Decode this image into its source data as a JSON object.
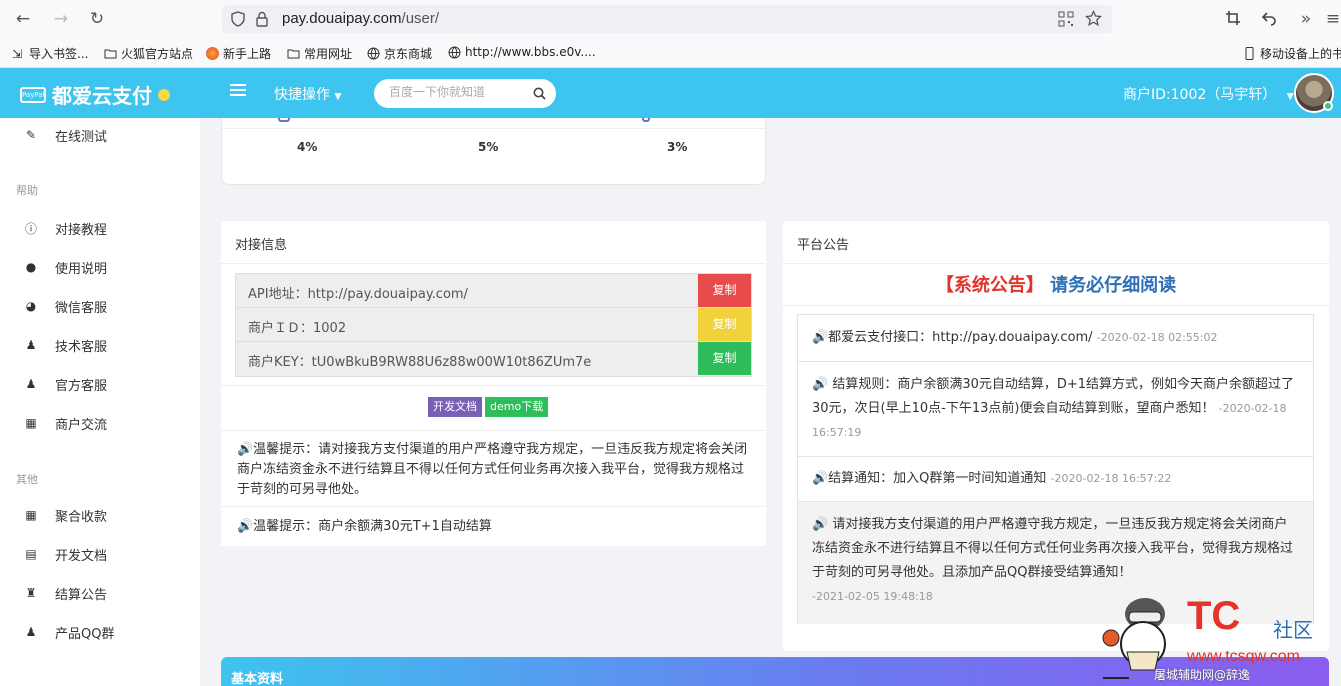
{
  "browser": {
    "url_host": "pay.douaipay.com",
    "url_path": "/user/",
    "bookmarks": [
      "导入书签...",
      "火狐官方站点",
      "新手上路",
      "常用网址",
      "京东商城",
      "http://www.bbs.e0v....",
      "移动设备上的书"
    ]
  },
  "header": {
    "brand": "都爱云支付",
    "brand_logo_text": "PayPal",
    "quick_menu": "快捷操作",
    "search_placeholder": "百度一下你就知道",
    "merchant": "商户ID:1002（马宇轩）"
  },
  "sidebar": {
    "top_item": "在线测试",
    "section_help": "帮助",
    "help_items": [
      "对接教程",
      "使用说明",
      "微信客服",
      "技术客服",
      "官方客服",
      "商户交流"
    ],
    "section_other": "其他",
    "other_items": [
      "聚合收款",
      "开发文档",
      "结算公告",
      "产品QQ群"
    ]
  },
  "stats": {
    "values": [
      "4%",
      "5%",
      "3%"
    ]
  },
  "dock": {
    "title": "对接信息",
    "rows": [
      {
        "text": "API地址：http://pay.douaipay.com/",
        "button": "复制",
        "color": "#e84b4b"
      },
      {
        "text": "商户ＩＤ：1002",
        "button": "复制",
        "color": "#f1d23a"
      },
      {
        "text": "商户KEY：tU0wBkuB9RW88U6z88w00W10t86ZUm7e",
        "button": "复制",
        "color": "#2ebd5a"
      }
    ],
    "doc_button": "开发文档",
    "demo_button": "demo下载",
    "tip1": "🔊温馨提示：请对接我方支付渠道的用户严格遵守我方规定，一旦违反我方规定将会关闭商户冻结资金永不进行结算且不得以任何方式任何业务再次接入我平台，觉得我方规格过于苛刻的可另寻他处。",
    "tip2": "🔊温馨提示：商户余额满30元T+1自动结算"
  },
  "notice": {
    "title": "平台公告",
    "headline_red": "【系统公告】",
    "headline_blue": "请务必仔细阅读",
    "items": [
      {
        "text": "🔊都爱云支付接口：http://pay.douaipay.com/",
        "time": "-2020-02-18 02:55:02"
      },
      {
        "text": "🔊 结算规则：商户余额满30元自动结算，D+1结算方式，例如今天商户余额超过了30元，次日(早上10点-下午13点前)便会自动结算到账，望商户悉知！",
        "time": "-2020-02-18 16:57:19"
      },
      {
        "text": "🔊结算通知：加入Q群第一时间知道通知",
        "time": "-2020-02-18 16:57:22"
      },
      {
        "text": "🔊 请对接我方支付渠道的用户严格遵守我方规定，一旦违反我方规定将会关闭商户冻结资金永不进行结算且不得以任何方式任何业务再次接入我平台，觉得我方规格过于苛刻的可另寻他处。且添加产品QQ群接受结算通知！",
        "time": "-2021-02-05 19:48:18"
      }
    ]
  },
  "basic": {
    "title": "基本资料"
  },
  "watermark": {
    "logo": "TC",
    "she": "社区",
    "url": "www.tcsqw.com",
    "sub": "屠城辅助网@辞逸"
  }
}
